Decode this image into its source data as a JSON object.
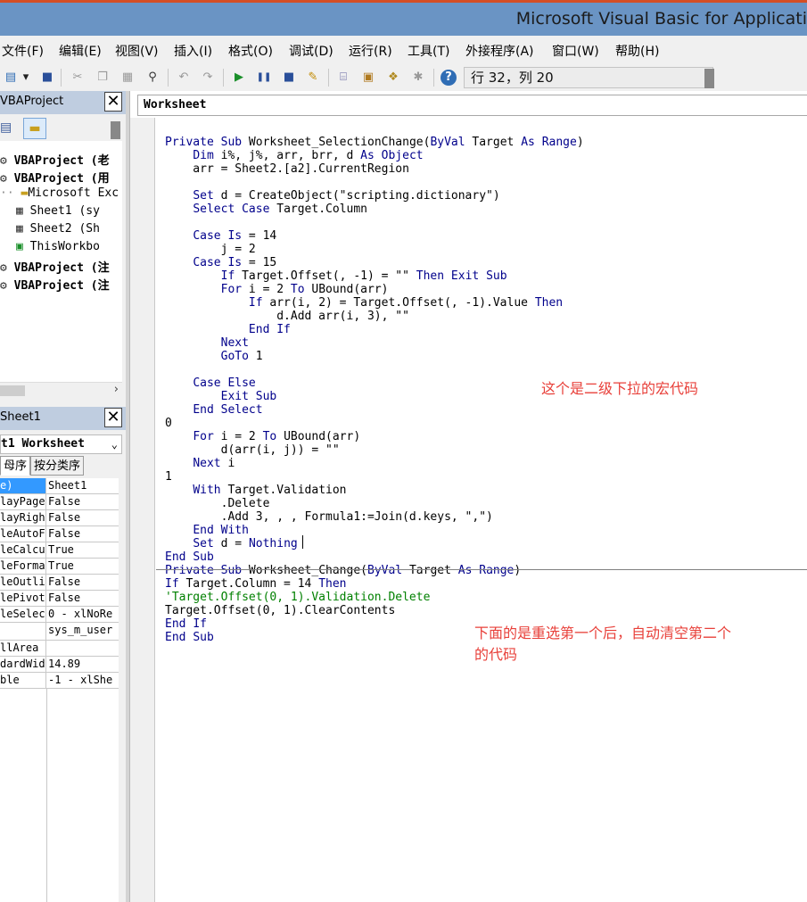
{
  "window": {
    "title": "Microsoft Visual Basic for Applicati"
  },
  "menu": {
    "items": [
      "文件(F)",
      "编辑(E)",
      "视图(V)",
      "插入(I)",
      "格式(O)",
      "调试(D)",
      "运行(R)",
      "工具(T)",
      "外接程序(A)",
      "窗口(W)",
      "帮助(H)"
    ]
  },
  "toolbar": {
    "status": "行 32，列 20",
    "icons": [
      "excel-icon",
      "save-icon",
      "cut-icon",
      "copy-icon",
      "paste-icon",
      "find-icon",
      "undo-icon",
      "redo-icon",
      "run-icon",
      "break-icon",
      "reset-icon",
      "design-mode-icon",
      "project-explorer-icon",
      "properties-icon",
      "object-browser-icon",
      "toolbox-icon",
      "help-icon"
    ]
  },
  "project_pane": {
    "title": "VBAProject",
    "tree": [
      {
        "label": "VBAProject (老",
        "bold": true
      },
      {
        "label": "VBAProject (用",
        "bold": true
      },
      {
        "label": "Microsoft Exc",
        "bold": false
      },
      {
        "label": "Sheet1 (sy",
        "bold": false
      },
      {
        "label": "Sheet2 (Sh",
        "bold": false
      },
      {
        "label": "ThisWorkbo",
        "bold": false
      },
      {
        "label": "VBAProject (注",
        "bold": true
      },
      {
        "label": "VBAProject (注",
        "bold": true
      }
    ]
  },
  "properties_pane": {
    "title": "Sheet1",
    "object": "t1 Worksheet",
    "tabs": [
      "母序",
      "按分类序"
    ],
    "rows": [
      {
        "k": "e)",
        "v": "Sheet1"
      },
      {
        "k": "layPage",
        "v": "False"
      },
      {
        "k": "layRigh",
        "v": "False"
      },
      {
        "k": "leAutoF",
        "v": "False"
      },
      {
        "k": "leCalcu",
        "v": "True"
      },
      {
        "k": "leForma",
        "v": "True"
      },
      {
        "k": "leOutli",
        "v": "False"
      },
      {
        "k": "lePivot",
        "v": "False"
      },
      {
        "k": "leSelec",
        "v": "0 - xlNoRe"
      },
      {
        "k": "",
        "v": "sys_m_user"
      },
      {
        "k": "llArea",
        "v": ""
      },
      {
        "k": "dardWid",
        "v": "14.89"
      },
      {
        "k": "ble",
        "v": "-1 - xlShe"
      }
    ]
  },
  "code_window": {
    "object_combo": "Worksheet",
    "lines": [
      "Private Sub Worksheet_SelectionChange(ByVal Target As Range)",
      "    Dim i%, j%, arr, brr, d As Object",
      "    arr = Sheet2.[a2].CurrentRegion",
      "",
      "    Set d = CreateObject(\"scripting.dictionary\")",
      "    Select Case Target.Column",
      "",
      "    Case Is = 14",
      "        j = 2",
      "    Case Is = 15",
      "        If Target.Offset(, -1) = \"\" Then Exit Sub",
      "        For i = 2 To UBound(arr)",
      "            If arr(i, 2) = Target.Offset(, -1).Value Then",
      "                d.Add arr(i, 3), \"\"",
      "            End If",
      "        Next",
      "        GoTo 1",
      "",
      "    Case Else",
      "        Exit Sub",
      "    End Select",
      "0",
      "    For i = 2 To UBound(arr)",
      "        d(arr(i, j)) = \"\"",
      "    Next i",
      "1",
      "    With Target.Validation",
      "        .Delete",
      "        .Add 3, , , Formula1:=Join(d.keys, \",\")",
      "    End With",
      "    Set d = Nothing",
      "End Sub",
      "Private Sub Worksheet_Change(ByVal Target As Range)",
      "If Target.Column = 14 Then",
      "'Target.Offset(0, 1).Validation.Delete",
      "Target.Offset(0, 1).ClearContents",
      "End If",
      "End Sub"
    ],
    "note1": "这个是二级下拉的宏代码",
    "note2_line1": "下面的是重选第一个后，自动清空第二个",
    "note2_line2": "的代码"
  }
}
